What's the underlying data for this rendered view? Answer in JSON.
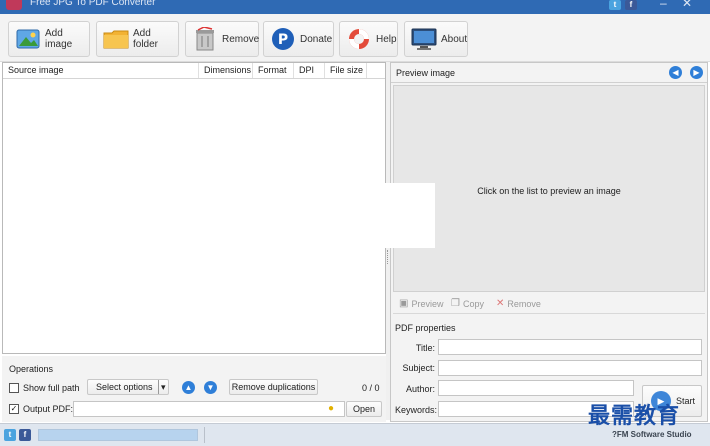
{
  "window": {
    "title": "Free JPG To PDF Converter"
  },
  "toolbar": {
    "add_image": "Add image",
    "add_folder": "Add folder",
    "remove": "Remove",
    "donate": "Donate",
    "help": "Help",
    "about": "About"
  },
  "table": {
    "columns": [
      "Source image",
      "Dimensions",
      "Format",
      "DPI",
      "File size"
    ]
  },
  "operations": {
    "heading": "Operations",
    "show_full_path": "Show full path",
    "show_full_path_checked": false,
    "select_options": "Select options",
    "remove_duplications": "Remove duplications",
    "count": "0 / 0",
    "output_pdf_label": "Output PDF:",
    "output_pdf_checked": true,
    "output_pdf_value": "",
    "open": "Open"
  },
  "preview": {
    "heading": "Preview image",
    "message": "Click on the list to preview an image",
    "preview_btn": "Preview",
    "copy_btn": "Copy",
    "remove_btn": "Remove"
  },
  "pdf_properties": {
    "heading": "PDF properties",
    "title_label": "Title:",
    "subject_label": "Subject:",
    "author_label": "Author:",
    "keywords_label": "Keywords:",
    "start": "Start"
  },
  "status": {
    "studio": "?FM Software Studio"
  },
  "watermark": "最需教育",
  "colors": {
    "accent": "#2f7fd8",
    "titlebar": "#2f6ab4",
    "statusbar": "#dfe6ef"
  }
}
